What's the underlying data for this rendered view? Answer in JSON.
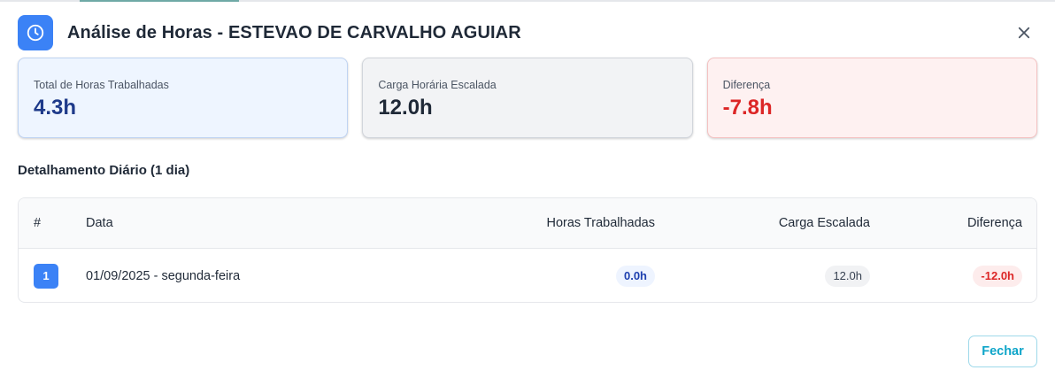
{
  "header": {
    "title": "Análise de Horas - ESTEVAO DE CARVALHO AGUIAR",
    "icon": "clock-icon",
    "close_icon": "close-icon"
  },
  "summary": {
    "worked": {
      "label": "Total de Horas Trabalhadas",
      "value": "4.3h"
    },
    "scheduled": {
      "label": "Carga Horária Escalada",
      "value": "12.0h"
    },
    "difference": {
      "label": "Diferença",
      "value": "-7.8h"
    }
  },
  "detail": {
    "title": "Detalhamento Diário (1 dia)",
    "columns": {
      "num": "#",
      "date": "Data",
      "worked": "Horas Trabalhadas",
      "scheduled": "Carga Escalada",
      "difference": "Diferença"
    },
    "rows": [
      {
        "num": "1",
        "date": "01/09/2025 - segunda-feira",
        "worked": "0.0h",
        "scheduled": "12.0h",
        "difference": "-12.0h"
      }
    ]
  },
  "footer": {
    "close_label": "Fechar"
  },
  "colors": {
    "accent": "#3b82f6",
    "negative": "#dc2626",
    "primary_dark": "#1e3a8a"
  }
}
